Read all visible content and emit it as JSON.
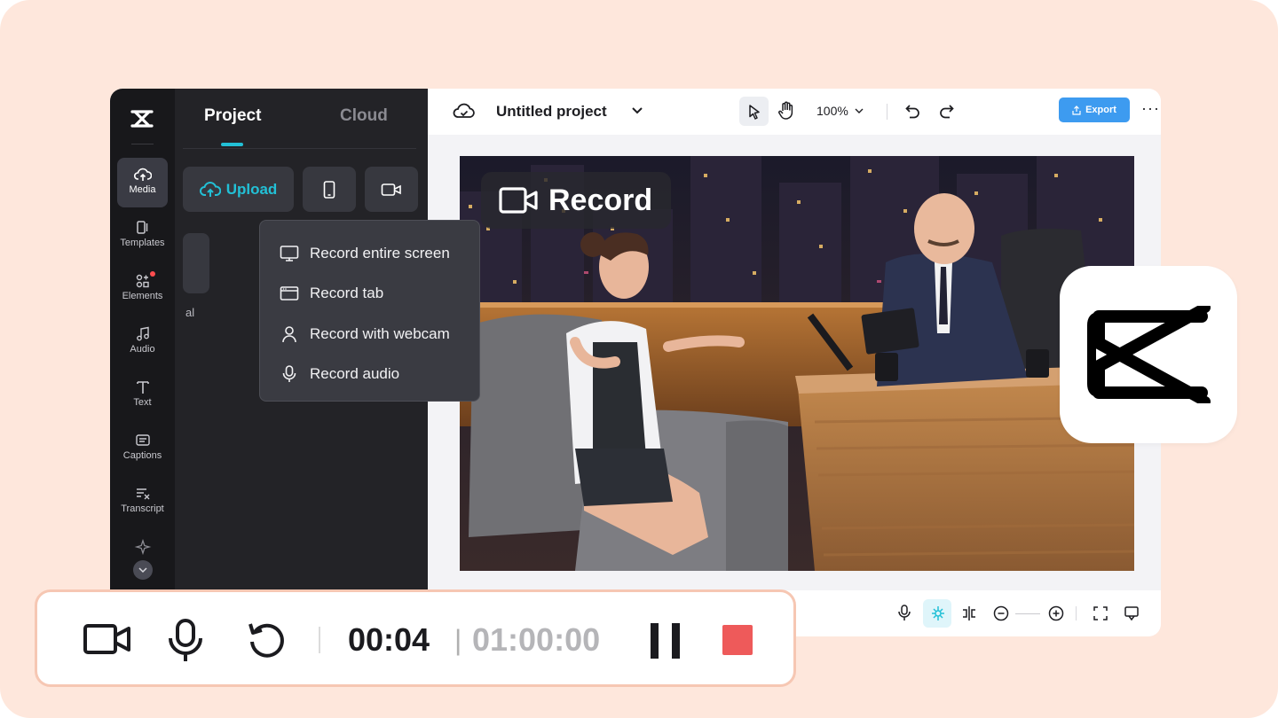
{
  "rail": {
    "items": [
      {
        "label": "Media",
        "icon": "cloud-upload-icon"
      },
      {
        "label": "Templates",
        "icon": "templates-icon"
      },
      {
        "label": "Elements",
        "icon": "elements-icon"
      },
      {
        "label": "Audio",
        "icon": "music-note-icon"
      },
      {
        "label": "Text",
        "icon": "text-icon"
      },
      {
        "label": "Captions",
        "icon": "captions-icon"
      },
      {
        "label": "Transcript",
        "icon": "transcript-icon"
      }
    ]
  },
  "panel": {
    "tabs": [
      "Project",
      "Cloud"
    ],
    "upload_label": "Upload",
    "ghost_text": "al",
    "record_menu": [
      {
        "label": "Record entire screen",
        "icon": "monitor-icon"
      },
      {
        "label": "Record tab",
        "icon": "browser-tab-icon"
      },
      {
        "label": "Record with webcam",
        "icon": "person-icon"
      },
      {
        "label": "Record audio",
        "icon": "microphone-icon"
      }
    ]
  },
  "topbar": {
    "project_title": "Untitled project",
    "zoom": "100%",
    "export_label": "Export",
    "more": "···"
  },
  "canvas": {
    "record_label": "Record"
  },
  "recorder": {
    "elapsed": "00:04",
    "separator": "|",
    "total": "01:00:00"
  },
  "colors": {
    "accent": "#22c0d6",
    "export": "#3d9bf0",
    "stop": "#ee5a5a",
    "background": "#fee7dc"
  }
}
